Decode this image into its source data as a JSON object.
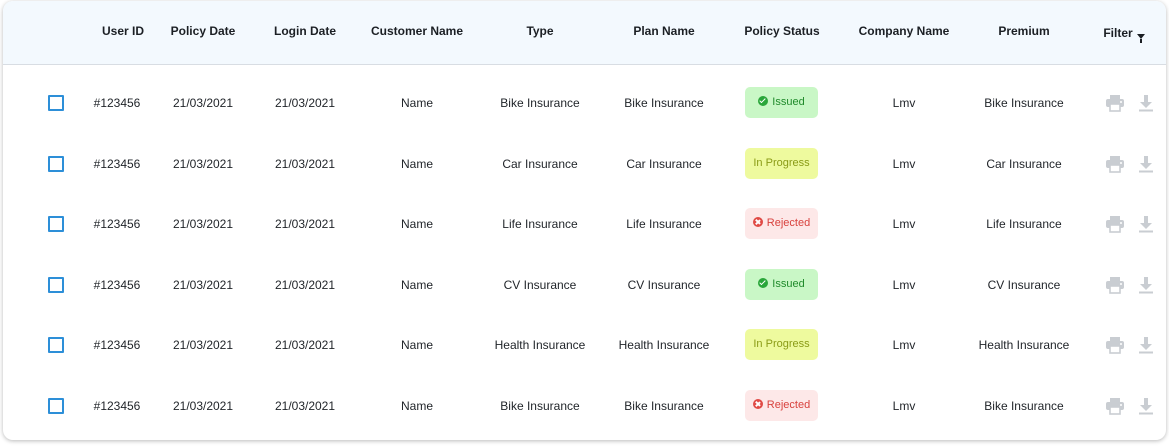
{
  "header": {
    "columns": [
      "User ID",
      "Policy Date",
      "Login Date",
      "Customer Name",
      "Type",
      "Plan Name",
      "Policy Status",
      "Company Name",
      "Premium"
    ],
    "filter_label": "Filter"
  },
  "status_styles": {
    "Issued": {
      "bg": "#c9f7c6",
      "fg": "#1f8a2a",
      "icon": "check-circle-icon",
      "dot": "#2aa63a"
    },
    "In Progress": {
      "bg": "#eefa9e",
      "fg": "#8a9b16",
      "icon": "",
      "dot": ""
    },
    "Rejected": {
      "bg": "#fde8e8",
      "fg": "#d8413d",
      "icon": "x-circle-icon",
      "dot": "#e04a45"
    }
  },
  "rows": [
    {
      "user_id": "#123456",
      "policy_date": "21/03/2021",
      "login_date": "21/03/2021",
      "customer": "Name",
      "type": "Bike Insurance",
      "plan": "Bike Insurance",
      "status": "Issued",
      "company": "Lmv",
      "premium": "Bike Insurance"
    },
    {
      "user_id": "#123456",
      "policy_date": "21/03/2021",
      "login_date": "21/03/2021",
      "customer": "Name",
      "type": "Car Insurance",
      "plan": "Car Insurance",
      "status": "In Progress",
      "company": "Lmv",
      "premium": "Car Insurance"
    },
    {
      "user_id": "#123456",
      "policy_date": "21/03/2021",
      "login_date": "21/03/2021",
      "customer": "Name",
      "type": "Life Insurance",
      "plan": "Life Insurance",
      "status": "Rejected",
      "company": "Lmv",
      "premium": "Life Insurance"
    },
    {
      "user_id": "#123456",
      "policy_date": "21/03/2021",
      "login_date": "21/03/2021",
      "customer": "Name",
      "type": "CV Insurance",
      "plan": "CV Insurance",
      "status": "Issued",
      "company": "Lmv",
      "premium": "CV Insurance"
    },
    {
      "user_id": "#123456",
      "policy_date": "21/03/2021",
      "login_date": "21/03/2021",
      "customer": "Name",
      "type": "Health Insurance",
      "plan": "Health Insurance",
      "status": "In Progress",
      "company": "Lmv",
      "premium": "Health Insurance"
    },
    {
      "user_id": "#123456",
      "policy_date": "21/03/2021",
      "login_date": "21/03/2021",
      "customer": "Name",
      "type": "Bike Insurance",
      "plan": "Bike Insurance",
      "status": "Rejected",
      "company": "Lmv",
      "premium": "Bike Insurance"
    }
  ],
  "actions": {
    "print_icon": "printer-icon",
    "download_icon": "download-icon",
    "icon_color": "#c9cdd2"
  }
}
